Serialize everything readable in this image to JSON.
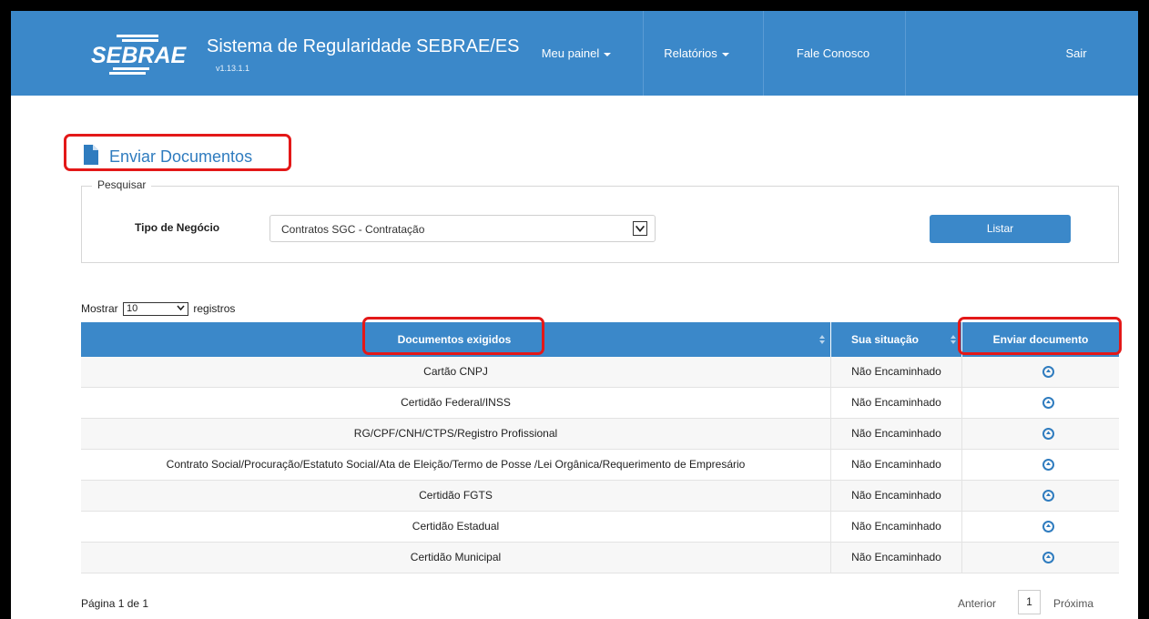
{
  "header": {
    "brand": "SEBRAE",
    "app_title": "Sistema de Regularidade SEBRAE/ES",
    "version": "v1.13.1.1",
    "nav": {
      "meu_painel": "Meu painel",
      "relatorios": "Relatórios",
      "fale_conosco": "Fale Conosco",
      "sair": "Sair"
    }
  },
  "page": {
    "title": "Enviar Documentos"
  },
  "search": {
    "legend": "Pesquisar",
    "tipo_label": "Tipo de Negócio",
    "tipo_value": "Contratos SGC - Contratação",
    "button": "Listar"
  },
  "list_controls": {
    "prefix": "Mostrar",
    "page_size": "10",
    "suffix": "registros"
  },
  "table": {
    "columns": [
      "Documentos exigidos",
      "Sua situação",
      "Enviar documento"
    ],
    "rows": [
      {
        "document": "Cartão CNPJ",
        "status": "Não Encaminhado",
        "action_icon": "upload-circle-icon"
      },
      {
        "document": "Certidão Federal/INSS",
        "status": "Não Encaminhado",
        "action_icon": "upload-circle-icon"
      },
      {
        "document": "RG/CPF/CNH/CTPS/Registro Profissional",
        "status": "Não Encaminhado",
        "action_icon": "upload-circle-icon"
      },
      {
        "document": "Contrato Social/Procuração/Estatuto Social/Ata de Eleição/Termo de Posse /Lei Orgânica/Requerimento de Empresário",
        "status": "Não Encaminhado",
        "action_icon": "upload-circle-icon"
      },
      {
        "document": "Certidão FGTS",
        "status": "Não Encaminhado",
        "action_icon": "upload-circle-icon"
      },
      {
        "document": "Certidão Estadual",
        "status": "Não Encaminhado",
        "action_icon": "upload-circle-icon"
      },
      {
        "document": "Certidão Municipal",
        "status": "Não Encaminhado",
        "action_icon": "upload-circle-icon"
      }
    ]
  },
  "pagination": {
    "info": "Página 1 de 1",
    "prev": "Anterior",
    "current": "1",
    "next": "Próxima"
  },
  "colors": {
    "primary": "#3b88c9",
    "highlight": "#e31818",
    "title": "#2f7cbf"
  }
}
